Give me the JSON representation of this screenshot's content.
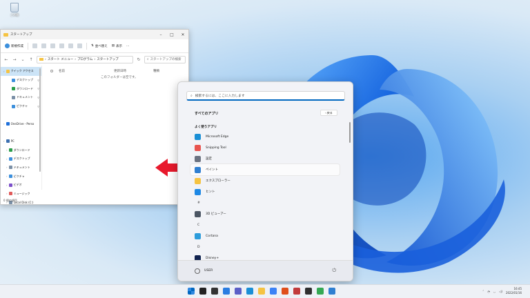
{
  "desktop": {
    "recycle_label": "ごみ箱"
  },
  "explorer": {
    "title": "スタートアップ",
    "command": {
      "new": "新規作成",
      "sort": "並べ替え",
      "view": "表示",
      "more": "…"
    },
    "address": {
      "path": [
        "スタート メニュー",
        "プログラム",
        "スタートアップ"
      ],
      "search_placeholder": "スタートアップの検索"
    },
    "nav": [
      {
        "label": "クイック アクセス",
        "color": "#f5c342",
        "indent": 0,
        "selected": true,
        "pin": false
      },
      {
        "label": "デスクトップ",
        "color": "#3c8fdc",
        "indent": 1,
        "pin": true
      },
      {
        "label": "ダウンロード",
        "color": "#2a9d4a",
        "indent": 1,
        "pin": true
      },
      {
        "label": "ドキュメント",
        "color": "#7a8fa6",
        "indent": 1,
        "pin": true
      },
      {
        "label": "ピクチャ",
        "color": "#3c8fdc",
        "indent": 1,
        "pin": true
      },
      {
        "label": "",
        "color": "",
        "indent": 0,
        "pin": false
      },
      {
        "label": "OneDrive - Perso",
        "color": "#1e6fd9",
        "indent": 0,
        "pin": false
      },
      {
        "label": "",
        "color": "",
        "indent": 0,
        "pin": false
      },
      {
        "label": "PC",
        "color": "#3c6fb0",
        "indent": 0,
        "pin": false
      },
      {
        "label": "ダウンロード",
        "color": "#2a9d4a",
        "indent": 2,
        "pin": false
      },
      {
        "label": "デスクトップ",
        "color": "#3c8fdc",
        "indent": 2,
        "pin": false
      },
      {
        "label": "ドキュメント",
        "color": "#7a8fa6",
        "indent": 2,
        "pin": false
      },
      {
        "label": "ピクチャ",
        "color": "#3c8fdc",
        "indent": 2,
        "pin": false
      },
      {
        "label": "ビデオ",
        "color": "#7b4fc9",
        "indent": 2,
        "pin": false
      },
      {
        "label": "ミュージック",
        "color": "#e05a5a",
        "indent": 2,
        "pin": false
      },
      {
        "label": "Local Disk (C:)",
        "color": "#7a8fa6",
        "indent": 2,
        "pin": false
      }
    ],
    "columns": {
      "name": "名前",
      "date": "更新日時",
      "type": "種類"
    },
    "empty_text": "このフォルダーは空です。",
    "status": "0 個の項目"
  },
  "start": {
    "search_placeholder": "検索するには、ここに入力します",
    "all_apps": "すべてのアプリ",
    "back": "戻る",
    "items": [
      {
        "kind": "section",
        "label": "よく使うアプリ"
      },
      {
        "kind": "app",
        "label": "Microsoft Edge",
        "color": "#1a8fd6"
      },
      {
        "kind": "app",
        "label": "Snipping Tool",
        "color": "#e8544f"
      },
      {
        "kind": "app",
        "label": "設定",
        "color": "#6b7280"
      },
      {
        "kind": "app",
        "label": "ペイント",
        "color": "#2f7fd1",
        "highlight": true
      },
      {
        "kind": "app",
        "label": "エクスプローラー",
        "color": "#f5c342"
      },
      {
        "kind": "app",
        "label": "ヒント",
        "color": "#1e88e5"
      },
      {
        "kind": "letter",
        "label": "#"
      },
      {
        "kind": "app",
        "label": "3D ビューアー",
        "color": "#4b5563"
      },
      {
        "kind": "letter",
        "label": "C"
      },
      {
        "kind": "app",
        "label": "Cortana",
        "color": "#2d9cdb"
      },
      {
        "kind": "letter",
        "label": "D"
      },
      {
        "kind": "app",
        "label": "Disney+",
        "color": "#10224f"
      }
    ],
    "user": "USER"
  },
  "taskbar": {
    "icons": [
      "start",
      "search",
      "task-view",
      "widgets",
      "chat",
      "edge",
      "explorer",
      "store",
      "office",
      "app",
      "app2",
      "chrome",
      "paint"
    ],
    "icon_colors": [
      "#0067c0",
      "#222",
      "#333",
      "#2a7de1",
      "#5b5fc7",
      "#1a8fd6",
      "#f5c342",
      "#3b82f6",
      "#e04e1a",
      "#c23b3b",
      "#2f2f2f",
      "#34a853",
      "#2f7fd1"
    ],
    "time": "16:45",
    "date": "2022/01/16"
  }
}
